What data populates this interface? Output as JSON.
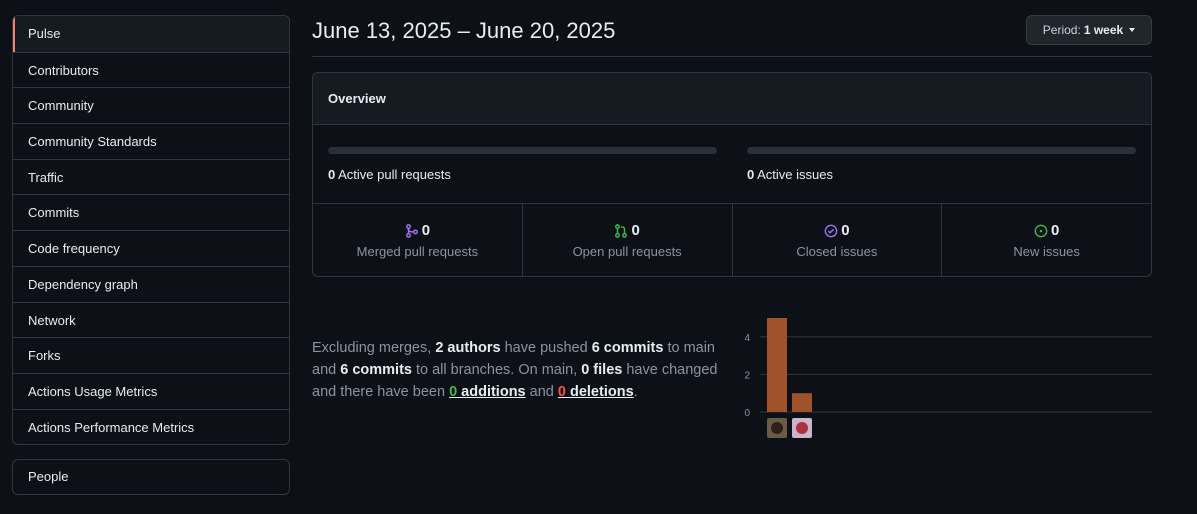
{
  "sidebar": {
    "items": [
      {
        "label": "Pulse",
        "selected": true
      },
      {
        "label": "Contributors"
      },
      {
        "label": "Community"
      },
      {
        "label": "Community Standards"
      },
      {
        "label": "Traffic"
      },
      {
        "label": "Commits"
      },
      {
        "label": "Code frequency"
      },
      {
        "label": "Dependency graph"
      },
      {
        "label": "Network"
      },
      {
        "label": "Forks"
      },
      {
        "label": "Actions Usage Metrics"
      },
      {
        "label": "Actions Performance Metrics"
      }
    ],
    "people_label": "People",
    "accent_color": "#f78166"
  },
  "header": {
    "date_range": "June 13, 2025 – June 20, 2025",
    "period_label": "Period:",
    "period_value": "1 week"
  },
  "overview": {
    "title": "Overview",
    "active_prs": {
      "count": "0",
      "label": "Active pull requests",
      "fill": 0
    },
    "active_issues": {
      "count": "0",
      "label": "Active issues",
      "fill": 0
    },
    "stats": [
      {
        "icon": "merge-icon",
        "value": "0",
        "label": "Merged pull requests",
        "color": "#a371f7"
      },
      {
        "icon": "pull-request-icon",
        "value": "0",
        "label": "Open pull requests",
        "color": "#3fb950"
      },
      {
        "icon": "closed-issue-icon",
        "value": "0",
        "label": "Closed issues",
        "color": "#a371f7"
      },
      {
        "icon": "open-issue-icon",
        "value": "0",
        "label": "New issues",
        "color": "#3fb950"
      }
    ]
  },
  "summary": {
    "p1": "Excluding merges, ",
    "authors": "2 authors",
    "p2": " have pushed ",
    "commits_main": "6 commits",
    "p3": " to main and ",
    "commits_all": "6 commits",
    "p4": " to all branches. On main, ",
    "files": "0 files",
    "p5": " have changed and there have been ",
    "additions_num": "0",
    "additions_word": " additions",
    "p6": " and ",
    "deletions_num": "0",
    "deletions_word": " deletions",
    "p7": "."
  },
  "chart_data": {
    "type": "bar",
    "categories": [
      "author-1",
      "author-2"
    ],
    "values": [
      5,
      1
    ],
    "yticks": [
      0,
      2,
      4
    ],
    "ylim": [
      0,
      5
    ],
    "bar_color": "#a0522d",
    "grid": true
  }
}
